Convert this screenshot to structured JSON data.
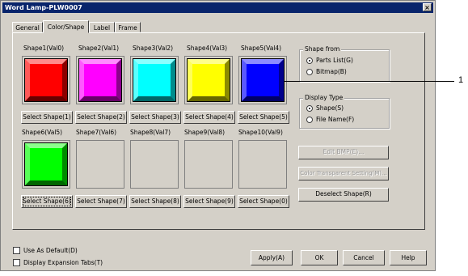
{
  "window": {
    "title": "Word Lamp-PLW0007",
    "close_label": "×"
  },
  "tabs": [
    "General",
    "Color/Shape",
    "Label",
    "Frame"
  ],
  "shapes_row1": [
    {
      "label": "Shape1(Val0)",
      "color": "#ff0000",
      "button": "Select Shape(1)"
    },
    {
      "label": "Shape2(Val1)",
      "color": "#ff00ff",
      "button": "Select Shape(2)"
    },
    {
      "label": "Shape3(Val2)",
      "color": "#00ffff",
      "button": "Select Shape(3)"
    },
    {
      "label": "Shape4(Val3)",
      "color": "#ffff00",
      "button": "Select Shape(4)"
    },
    {
      "label": "Shape5(Val4)",
      "color": "#0000ff",
      "button": "Select Shape(5)"
    }
  ],
  "shapes_row2": [
    {
      "label": "Shape6(Val5)",
      "color": "#00ff00",
      "button": "Select Shape(6)"
    },
    {
      "label": "Shape7(Val6)",
      "color": "",
      "button": "Select Shape(7)"
    },
    {
      "label": "Shape8(Val7)",
      "color": "",
      "button": "Select Shape(8)"
    },
    {
      "label": "Shape9(Val8)",
      "color": "",
      "button": "Select Shape(9)"
    },
    {
      "label": "Shape10(Val9)",
      "color": "",
      "button": "Select Shape(0)"
    }
  ],
  "shape_from": {
    "title": "Shape from",
    "options": [
      "Parts List(G)",
      "Bitmap(B)"
    ],
    "selected": 0
  },
  "display_type": {
    "title": "Display Type",
    "options": [
      "Shape(S)",
      "File Name(F)"
    ],
    "selected": 0
  },
  "side_buttons": {
    "edit_bmp": "Edit BMP(E)...",
    "transparent": "Color Transparent Setting(M)...",
    "deselect": "Deselect Shape(R)"
  },
  "checkboxes": {
    "use_default": "Use As Default(D)",
    "expansion_tabs": "Display Expansion Tabs(T)"
  },
  "footer": {
    "apply": "Apply(A)",
    "ok": "OK",
    "cancel": "Cancel",
    "help": "Help"
  },
  "callout": "1"
}
